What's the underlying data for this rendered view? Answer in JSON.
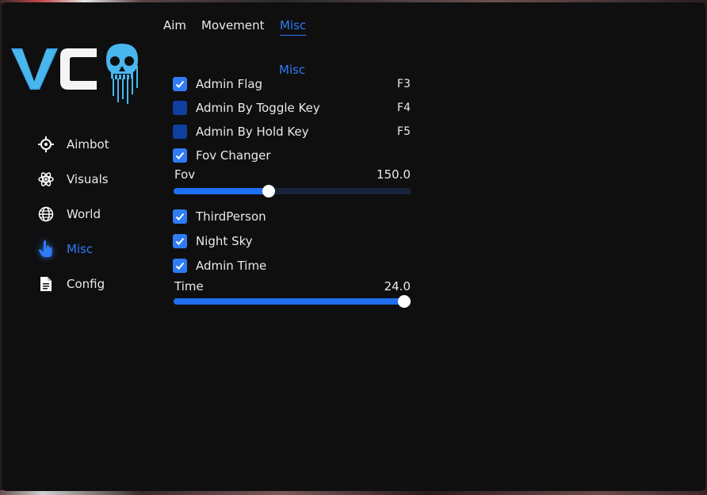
{
  "tabs": [
    {
      "label": "Aim",
      "active": false
    },
    {
      "label": "Movement",
      "active": false
    },
    {
      "label": "Misc",
      "active": true
    }
  ],
  "sidebar": {
    "items": [
      {
        "label": "Aimbot",
        "icon": "crosshair-icon",
        "active": false
      },
      {
        "label": "Visuals",
        "icon": "atom-icon",
        "active": false
      },
      {
        "label": "World",
        "icon": "globe-icon",
        "active": false
      },
      {
        "label": "Misc",
        "icon": "pointer-hand-icon",
        "active": true
      },
      {
        "label": "Config",
        "icon": "document-icon",
        "active": false
      }
    ]
  },
  "logo": {
    "text": "VC",
    "icon": "skull-icon"
  },
  "section": {
    "title": "Misc"
  },
  "options": [
    {
      "label": "Admin Flag",
      "checked": true,
      "key": "F3"
    },
    {
      "label": "Admin By Toggle Key",
      "checked": false,
      "key": "F4"
    },
    {
      "label": "Admin By Hold Key",
      "checked": false,
      "key": "F5"
    },
    {
      "label": "Fov Changer",
      "checked": true,
      "key": ""
    }
  ],
  "fov_slider": {
    "label": "Fov",
    "value": "150.0",
    "fraction": 0.4
  },
  "options2": [
    {
      "label": "ThirdPerson",
      "checked": true
    },
    {
      "label": "Night Sky",
      "checked": true
    },
    {
      "label": "Admin Time",
      "checked": true
    }
  ],
  "time_slider": {
    "label": "Time",
    "value": "24.0",
    "fraction": 0.97
  },
  "colors": {
    "accent": "#2f7cf6",
    "checkbox_off": "#0f3f9f",
    "background": "#0f0f10",
    "text": "#e9e9ee"
  }
}
